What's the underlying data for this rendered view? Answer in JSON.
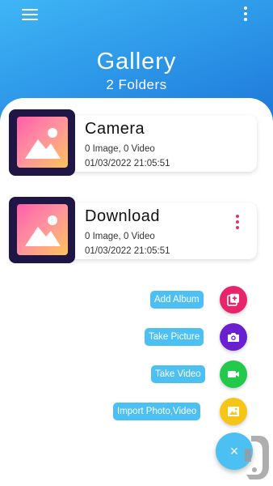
{
  "header": {
    "title": "Gallery",
    "subtitle": "2 Folders",
    "menu_icon": "hamburger-menu-icon",
    "more_icon": "vertical-dots-icon",
    "gradient_colors": [
      "#3fb6f5",
      "#1b73d6"
    ]
  },
  "folders": [
    {
      "name": "Camera",
      "counts": "0 Image, 0 Video",
      "date": "01/03/2022 21:05:51"
    },
    {
      "name": "Download",
      "counts": "0 Image, 0 Video",
      "date": "01/03/2022 21:05:51"
    }
  ],
  "actions": [
    {
      "label": "Add Album",
      "icon": "add-album-icon",
      "color": "#e8246b"
    },
    {
      "label": "Take Picture",
      "icon": "camera-icon",
      "color": "#6a1fd0"
    },
    {
      "label": "Take Video",
      "icon": "videocam-icon",
      "color": "#22c94a"
    },
    {
      "label": "Import Photo,Video",
      "icon": "image-icon",
      "color": "#f5c518"
    }
  ],
  "fab": {
    "symbol": "×",
    "icon": "close-icon",
    "color": "#4cc0f2"
  },
  "watermark": {
    "icon": "store-logo-icon"
  }
}
